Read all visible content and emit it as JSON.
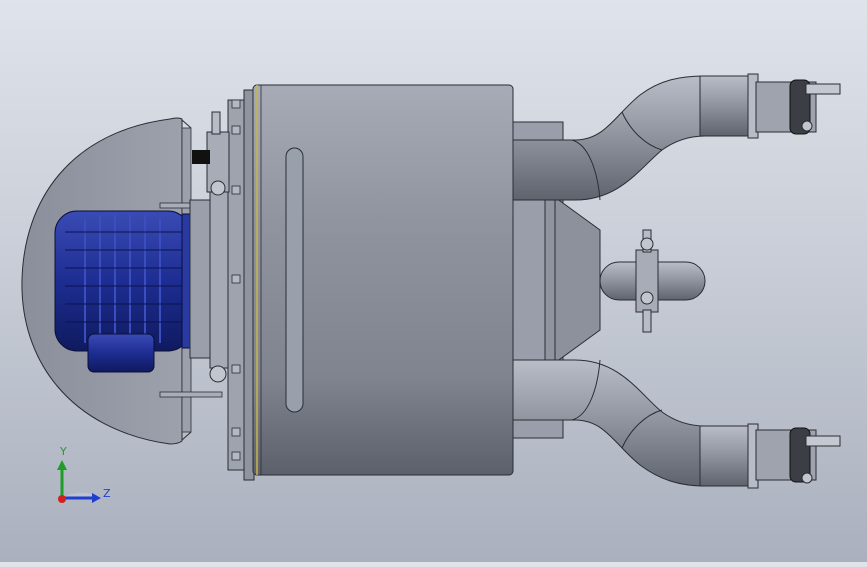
{
  "viewport": {
    "background_top": "#dfe3ea",
    "background_bottom": "#aab0bd",
    "model_color": "#8e939f",
    "motor_color": "#1b2a8c",
    "shell_outline": "#2a2d33",
    "accent_yellow": "#c8b44a"
  },
  "triad": {
    "x_color": "#d21f1f",
    "y_color": "#1f9d2a",
    "z_color": "#1f3fcf",
    "y_label": "Y",
    "z_label": "Z"
  },
  "icons": [
    "coordinate-triad-icon"
  ]
}
